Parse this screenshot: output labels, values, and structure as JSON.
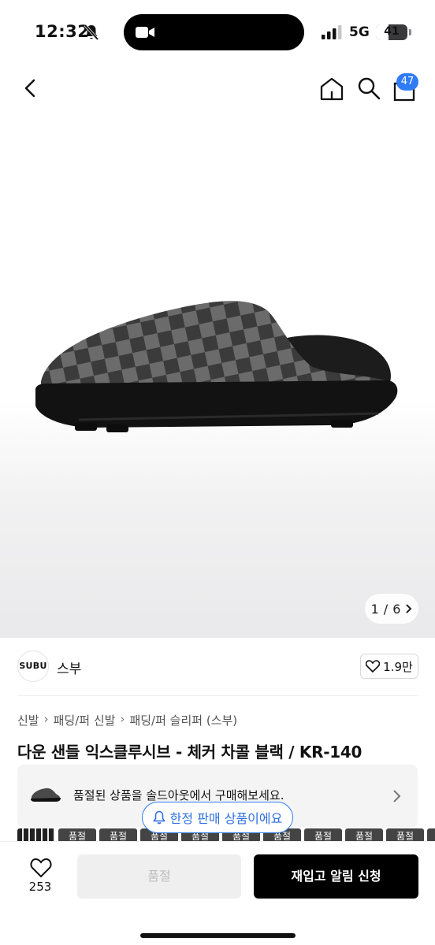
{
  "status_bar": {
    "time": "12:32",
    "network": "5G",
    "battery": "41",
    "battery_level": 0.41
  },
  "nav": {
    "back_icon": "chevron-left-icon",
    "home_icon": "home-icon",
    "search_icon": "search-icon",
    "bag_icon": "shopping-bag-icon",
    "cart_count": "47"
  },
  "gallery": {
    "counter_current": "1",
    "counter_sep": "/",
    "counter_total": "6"
  },
  "brand": {
    "logo_text": "SUBU",
    "name": "스부",
    "likes": "1.9만"
  },
  "breadcrumb": [
    "신발",
    "패딩/퍼 신발",
    "패딩/퍼 슬리퍼 (스부)"
  ],
  "product": {
    "title": "다운 샌들 익스클루시브 - 체커 차콜 블랙 / KR-140"
  },
  "soldout_notice": {
    "text": "품절된 상품을 솔드아웃에서 구매해보세요."
  },
  "limited_badge": {
    "text": "한정 판매 상품이에요"
  },
  "thumbnails": {
    "labels": [
      "",
      "품절",
      "품절",
      "품절",
      "품절",
      "품절",
      "품절",
      "품절",
      "품절",
      "품절",
      "품절"
    ]
  },
  "bottom_bar": {
    "wish_count": "253",
    "soldout_label": "품절",
    "notify_label": "재입고 알림 신청"
  },
  "colors": {
    "accent": "#2f7cf6",
    "primary_button": "#000000"
  }
}
